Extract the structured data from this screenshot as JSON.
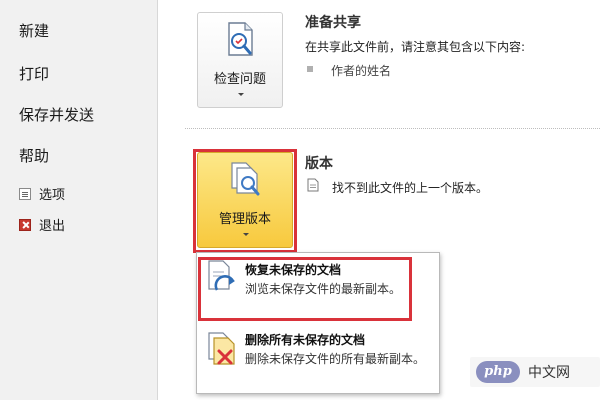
{
  "sidebar": {
    "items": [
      {
        "label": "新建"
      },
      {
        "label": "打印"
      },
      {
        "label": "保存并发送"
      },
      {
        "label": "帮助"
      }
    ],
    "options_label": "选项",
    "exit_label": "退出"
  },
  "inspect": {
    "button_label": "检查问题",
    "title": "准备共享",
    "desc": "在共享此文件前，请注意其包含以下内容:",
    "bullet": "作者的姓名"
  },
  "versions": {
    "button_label": "管理版本",
    "title": "版本",
    "desc": "找不到此文件的上一个版本。"
  },
  "dropdown": {
    "items": [
      {
        "title": "恢复未保存的文档",
        "desc": "浏览未保存文件的最新副本。"
      },
      {
        "title": "删除所有未保存的文档",
        "desc": "删除未保存文件的所有最新副本。"
      }
    ]
  },
  "watermark": {
    "logo": "php",
    "text": "中文网"
  },
  "colors": {
    "highlight": "#d9323a",
    "manage_button": "#f8d34e"
  }
}
